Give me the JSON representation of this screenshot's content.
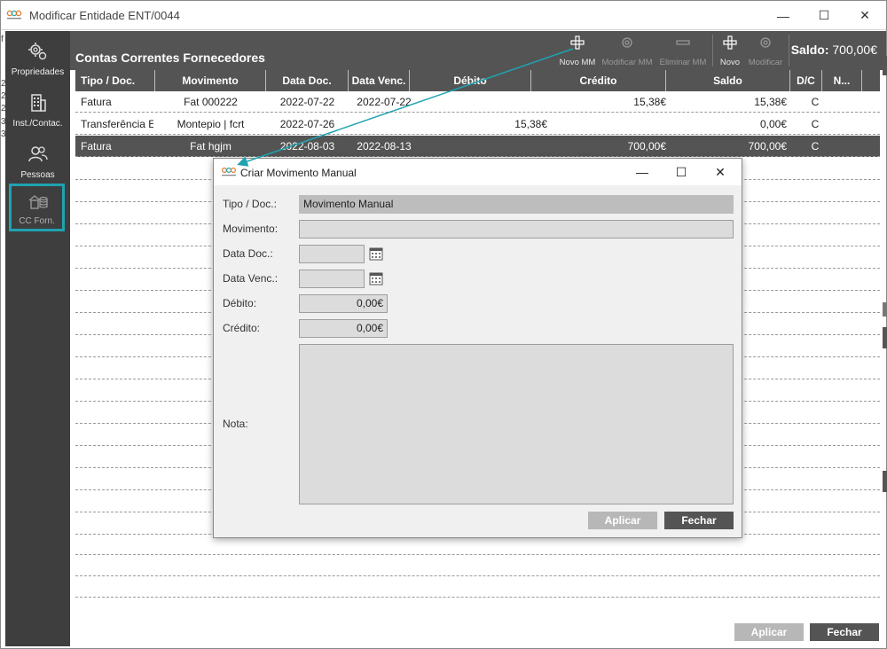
{
  "window": {
    "title": "Modificar Entidade ENT/0044",
    "controls": {
      "minimize": "—",
      "maximize": "☐",
      "close": "✕"
    }
  },
  "bleed": [
    "f",
    "2",
    "2",
    "2",
    "3",
    "3"
  ],
  "sidebar": {
    "items": [
      {
        "label": "Propriedades",
        "icon": "gear-icon"
      },
      {
        "label": "Inst./Contac.",
        "icon": "building-icon"
      },
      {
        "label": "Pessoas",
        "icon": "people-icon"
      },
      {
        "label": "CC Forn.",
        "icon": "bank-icon",
        "active": true
      }
    ]
  },
  "header": {
    "title": "Contas Correntes Fornecedores",
    "toolbar": [
      {
        "label": "Novo MM",
        "icon": "plus-icon",
        "enabled": true
      },
      {
        "label": "Modificar MM",
        "icon": "gear-icon",
        "enabled": false
      },
      {
        "label": "Eliminar MM",
        "icon": "minus-icon",
        "enabled": false
      },
      {
        "label": "Novo",
        "icon": "plus-icon",
        "enabled": true
      },
      {
        "label": "Modificar",
        "icon": "gear-icon",
        "enabled": false
      }
    ],
    "saldo_label": "Saldo:",
    "saldo_value": "700,00€"
  },
  "table": {
    "columns": [
      "Tipo / Doc.",
      "Movimento",
      "Data Doc.",
      "Data Venc.",
      "Débito",
      "Crédito",
      "Saldo",
      "D/C",
      "N..."
    ],
    "rows": [
      {
        "tipo": "Fatura",
        "movimento": "Fat 000222",
        "data_doc": "2022-07-22",
        "data_venc": "2022-07-22",
        "debito": "",
        "credito": "15,38€",
        "saldo": "15,38€",
        "dc": "C"
      },
      {
        "tipo": "Transferência E",
        "movimento": "Montepio | fcrt",
        "data_doc": "2022-07-26",
        "data_venc": "",
        "debito": "15,38€",
        "credito": "",
        "saldo": "0,00€",
        "dc": "C"
      },
      {
        "tipo": "Fatura",
        "movimento": "Fat hgjm",
        "data_doc": "2022-08-03",
        "data_venc": "2022-08-13",
        "debito": "",
        "credito": "700,00€",
        "saldo": "700,00€",
        "dc": "C",
        "selected": true
      }
    ]
  },
  "footer": {
    "apply_label": "Aplicar",
    "close_label": "Fechar"
  },
  "dialog": {
    "title": "Criar Movimento Manual",
    "controls": {
      "minimize": "—",
      "maximize": "☐",
      "close": "✕"
    },
    "labels": {
      "tipo": "Tipo / Doc.:",
      "movimento": "Movimento:",
      "data_doc": "Data Doc.:",
      "data_venc": "Data Venc.:",
      "debito": "Débito:",
      "credito": "Crédito:",
      "nota": "Nota:"
    },
    "values": {
      "tipo": "Movimento Manual",
      "movimento": "",
      "data_doc": "",
      "data_venc": "",
      "debito": "0,00€",
      "credito": "0,00€",
      "nota": ""
    },
    "apply_label": "Aplicar",
    "close_label": "Fechar"
  },
  "colors": {
    "accent": "#1fa3b0",
    "dark": "#545454",
    "sidebar": "#3e3e3e"
  }
}
